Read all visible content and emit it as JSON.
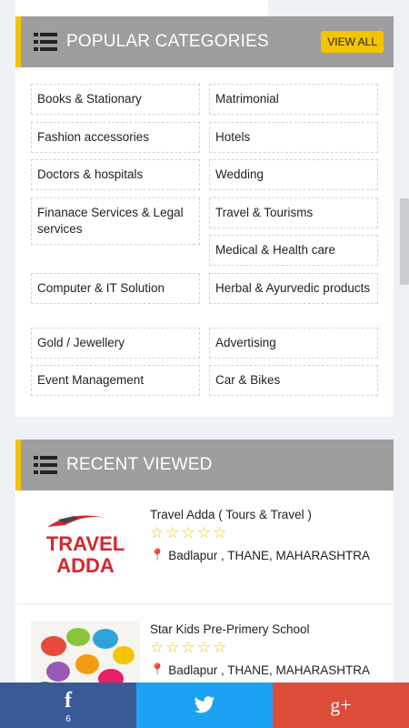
{
  "categories": {
    "title": "POPULAR CATEGORIES",
    "view_all": "VIEW ALL",
    "items": [
      "Books & Stationary",
      "Matrimonial",
      "Fashion accessories",
      "Hotels",
      "Doctors & hospitals",
      "Wedding",
      "Finanace Services & Legal services",
      "Travel & Tourisms",
      "Medical & Health care",
      "Computer & IT Solution",
      "Herbal & Ayurvedic products",
      "Gold / Jewellery",
      "Advertising",
      "Event Management",
      "Car & Bikes"
    ]
  },
  "recent": {
    "title": "RECENT VIEWED",
    "items": [
      {
        "name": "Travel Adda ( Tours & Travel )",
        "logo_line1": "TRAVEL",
        "logo_line2": "ADDA",
        "stars": "☆☆☆☆☆",
        "location": "Badlapur , THANE, MAHARASHTRA"
      },
      {
        "name": "Star Kids Pre-Primery School",
        "stars": "☆☆☆☆☆",
        "location": "Badlapur , THANE, MAHARASHTRA"
      }
    ]
  },
  "share": {
    "facebook_glyph": "f",
    "facebook_count": "6",
    "twitter_icon": "twitter-bird-icon",
    "googleplus_glyph": "g+"
  },
  "colors": {
    "accent_yellow": "#f4c400",
    "header_gray": "#9e9e9e",
    "facebook": "#3a5a97",
    "twitter": "#1da1f2",
    "googleplus": "#dd4b39",
    "logo_red": "#d7262f"
  }
}
